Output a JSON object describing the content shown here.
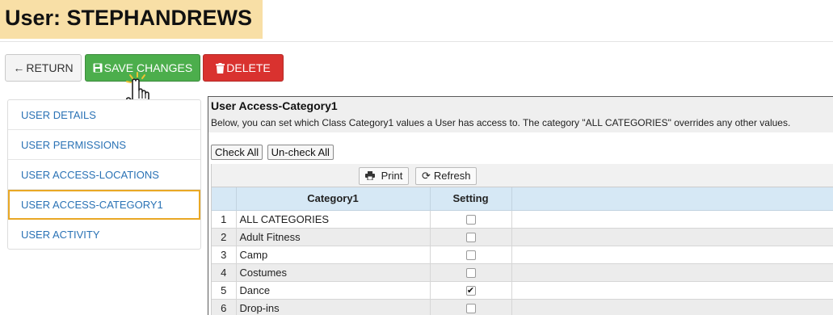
{
  "page": {
    "title": "User: STEPHANDREWS"
  },
  "actions": {
    "return_label": "RETURN",
    "save_label": "SAVE CHANGES",
    "delete_label": "DELETE"
  },
  "sidebar": {
    "items": [
      {
        "label": "USER DETAILS",
        "active": false
      },
      {
        "label": "USER PERMISSIONS",
        "active": false
      },
      {
        "label": "USER ACCESS-LOCATIONS",
        "active": false
      },
      {
        "label": "USER ACCESS-CATEGORY1",
        "active": true
      },
      {
        "label": "USER ACTIVITY",
        "active": false
      }
    ]
  },
  "content": {
    "title": "User Access-Category1",
    "description": "Below, you can set which Class Category1 values a User has access to. The category \"ALL CATEGORIES\" overrides any other values.",
    "check_all_label": "Check All",
    "uncheck_all_label": "Un-check All",
    "print_label": "Print",
    "refresh_label": "Refresh",
    "columns": {
      "category": "Category1",
      "setting": "Setting"
    },
    "rows": [
      {
        "num": "1",
        "category": "ALL CATEGORIES",
        "checked": false
      },
      {
        "num": "2",
        "category": "Adult Fitness",
        "checked": false
      },
      {
        "num": "3",
        "category": "Camp",
        "checked": false
      },
      {
        "num": "4",
        "category": "Costumes",
        "checked": false
      },
      {
        "num": "5",
        "category": "Dance",
        "checked": true
      },
      {
        "num": "6",
        "category": "Drop-ins",
        "checked": false
      }
    ]
  },
  "colors": {
    "title_highlight": "#f8dfa6",
    "save_green": "#4cae4c",
    "delete_red": "#d9322f",
    "active_border": "#e9a825",
    "link_blue": "#2a72b5",
    "header_blue": "#d6e8f5"
  }
}
